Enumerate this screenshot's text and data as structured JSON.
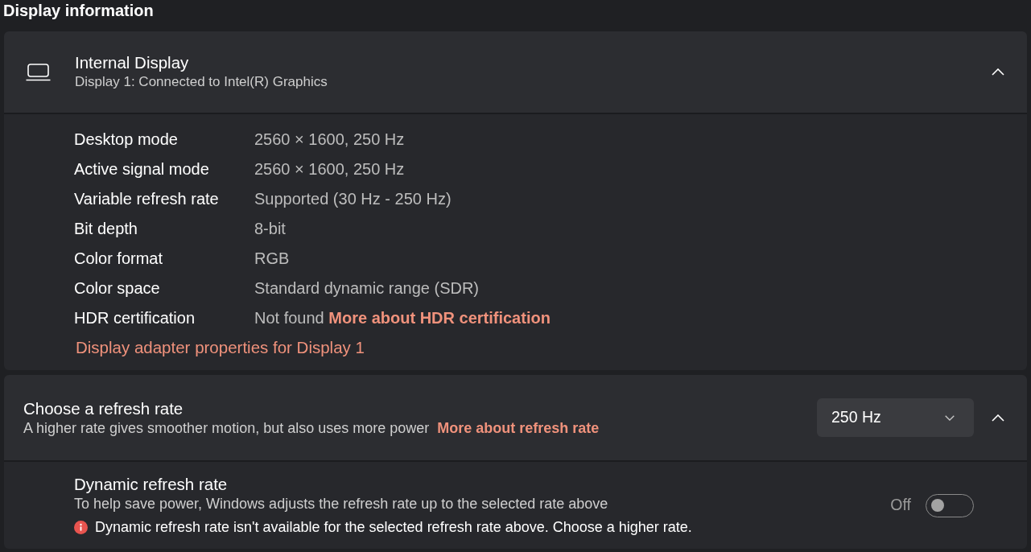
{
  "page_title": "Display information",
  "display_card": {
    "title": "Internal Display",
    "subtitle": "Display 1: Connected to Intel(R) Graphics",
    "expanded": true,
    "properties": [
      {
        "label": "Desktop mode",
        "value": "2560 × 1600, 250 Hz"
      },
      {
        "label": "Active signal mode",
        "value": "2560 × 1600, 250 Hz"
      },
      {
        "label": "Variable refresh rate",
        "value": "Supported (30 Hz - 250 Hz)"
      },
      {
        "label": "Bit depth",
        "value": "8-bit"
      },
      {
        "label": "Color format",
        "value": "RGB"
      },
      {
        "label": "Color space",
        "value": "Standard dynamic range (SDR)"
      },
      {
        "label": "HDR certification",
        "value": "Not found",
        "link": "More about HDR certification"
      }
    ],
    "adapter_link": "Display adapter properties for Display 1"
  },
  "refresh_rate": {
    "title": "Choose a refresh rate",
    "description": "A higher rate gives smoother motion, but also uses more power",
    "link": "More about refresh rate",
    "dropdown": {
      "value": "250 Hz"
    },
    "expanded": true,
    "dynamic": {
      "title": "Dynamic refresh rate",
      "description": "To help save power, Windows adjusts the refresh rate up to the selected rate above",
      "warning": "Dynamic refresh rate isn't available for the selected refresh rate above. Choose a higher rate.",
      "toggle": {
        "label": "Off",
        "on": false
      }
    }
  }
}
